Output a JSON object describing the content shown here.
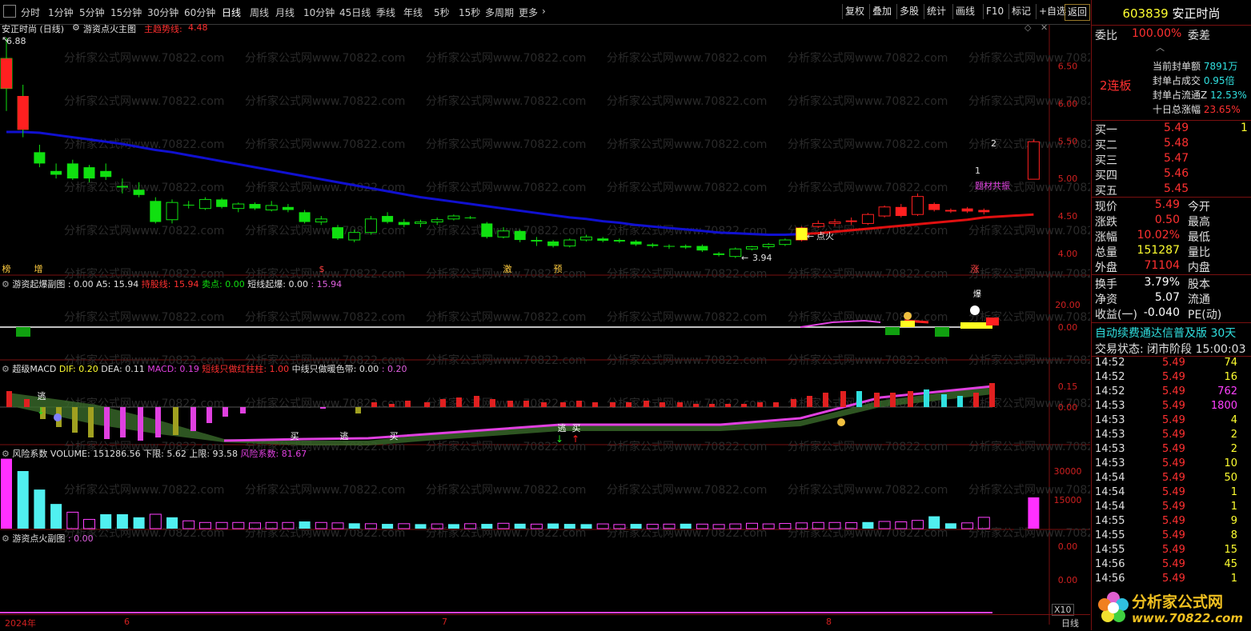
{
  "toolbar": {
    "menu_icon": "menu-icon",
    "periods": [
      "分时",
      "1分钟",
      "5分钟",
      "15分钟",
      "30分钟",
      "60分钟",
      "日线",
      "周线",
      "月线",
      "10分钟",
      "45日线",
      "季线",
      "年线",
      "5秒",
      "15秒",
      "多周期",
      "更多"
    ],
    "active_period": "日线",
    "right": [
      "复权",
      "叠加",
      "多股",
      "统计",
      "画线",
      "F10",
      "标记",
      "+自选",
      "返回"
    ]
  },
  "main": {
    "stock_title": "安正时尚 (日线)",
    "indicator_name": "游资点火主图",
    "trend_label": "主趋势线:",
    "trend_value": "4.48",
    "high_mark": "6.88",
    "low_mark": "3.94",
    "ignite_label": "点火",
    "theme_label": "题材共振",
    "num_1": "1",
    "num_2": "2",
    "y_ticks": [
      "6.50",
      "6.00",
      "5.50",
      "5.00",
      "4.50",
      "4.00"
    ],
    "tags": [
      "榜",
      "增",
      "$",
      "激",
      "预",
      "涨"
    ]
  },
  "panel2": {
    "title": "游资起爆副图 : 0.00",
    "a5": "A5: 15.94",
    "hold_label": "持股线:",
    "hold_value": "15.94",
    "sell_label": "卖点:",
    "sell_value": "0.00",
    "short_label": "短线起爆:",
    "short_value": "0.00",
    "extra_value": ": 15.94",
    "bao_label": "爆",
    "y_ticks": [
      "20.00",
      "0.00"
    ]
  },
  "panel3": {
    "title": "超级MACD",
    "dif": "DIF: 0.20",
    "dea": "DEA: 0.11",
    "macd": "MACD: 0.19",
    "short_red": "短线只做红柱柱:",
    "short_red_value": "1.00",
    "mid_warm": "中线只做暖色带:",
    "mid_warm_value": "0.00",
    "mid_warm_value2": ": 0.20",
    "escape_label": "逃",
    "buy_label": "买",
    "y_ticks": [
      "0.15",
      "0.00"
    ]
  },
  "panel4": {
    "title": "风险系数",
    "volume": "VOLUME: 151286.56",
    "lower": "下限: 5.62",
    "upper": "上限: 93.58",
    "risk": "风险系数: 81.67",
    "y_ticks": [
      "30000",
      "15000"
    ],
    "x10": "X10"
  },
  "panel5": {
    "title": "游资点火副图",
    "value": ": 0.00",
    "y_ticks": [
      "0.00",
      "0.00"
    ]
  },
  "date_axis": {
    "labels": [
      "2024年",
      "6",
      "7",
      "8"
    ],
    "period_btn": "日线"
  },
  "watermark": "分析家公式网www.70822.com",
  "side": {
    "code": "603839",
    "name": "安正时尚",
    "wei_bi_label": "委比",
    "wei_bi_value": "100.00%",
    "wei_cha_label": "委差",
    "lianban": "2连板",
    "seal": [
      {
        "label": "当前封单额",
        "value": "7891万"
      },
      {
        "label": "封单占成交",
        "value": "0.95倍"
      },
      {
        "label": "封单占流通Z",
        "value": "12.53%"
      },
      {
        "label": "十日总涨幅",
        "value": "23.65%"
      }
    ],
    "bids": [
      {
        "label": "买一",
        "price": "5.49",
        "vol": "1"
      },
      {
        "label": "买二",
        "price": "5.48",
        "vol": ""
      },
      {
        "label": "买三",
        "price": "5.47",
        "vol": ""
      },
      {
        "label": "买四",
        "price": "5.46",
        "vol": ""
      },
      {
        "label": "买五",
        "price": "5.45",
        "vol": ""
      }
    ],
    "quote": [
      {
        "l1": "现价",
        "v1": "5.49",
        "l2": "今开",
        "c": "red"
      },
      {
        "l1": "涨跌",
        "v1": "0.50",
        "l2": "最高",
        "c": "red"
      },
      {
        "l1": "涨幅",
        "v1": "10.02%",
        "l2": "最低",
        "c": "red"
      },
      {
        "l1": "总量",
        "v1": "151287",
        "l2": "量比",
        "c": "yellow"
      },
      {
        "l1": "外盘",
        "v1": "71104",
        "l2": "内盘",
        "c": "red"
      }
    ],
    "stats": [
      {
        "l1": "换手",
        "v1": "3.79%",
        "l2": "股本"
      },
      {
        "l1": "净资",
        "v1": "5.07",
        "l2": "流通"
      },
      {
        "l1": "收益(一)",
        "v1": "-0.040",
        "l2": "PE(动)"
      }
    ],
    "marquee": "自动续费通达信普及版  30天",
    "trade_status": "交易状态: 闭市阶段 15:00:03",
    "ticks": [
      {
        "t": "14:52",
        "p": "5.49",
        "v": "74",
        "c": "yellow"
      },
      {
        "t": "14:52",
        "p": "5.49",
        "v": "16",
        "c": "yellow"
      },
      {
        "t": "14:52",
        "p": "5.49",
        "v": "762",
        "c": "magenta"
      },
      {
        "t": "14:53",
        "p": "5.49",
        "v": "1800",
        "c": "magenta"
      },
      {
        "t": "14:53",
        "p": "5.49",
        "v": "4",
        "c": "yellow"
      },
      {
        "t": "14:53",
        "p": "5.49",
        "v": "2",
        "c": "yellow"
      },
      {
        "t": "14:53",
        "p": "5.49",
        "v": "2",
        "c": "yellow"
      },
      {
        "t": "14:53",
        "p": "5.49",
        "v": "10",
        "c": "yellow"
      },
      {
        "t": "14:54",
        "p": "5.49",
        "v": "50",
        "c": "yellow"
      },
      {
        "t": "14:54",
        "p": "5.49",
        "v": "1",
        "c": "yellow"
      },
      {
        "t": "14:54",
        "p": "5.49",
        "v": "1",
        "c": "yellow"
      },
      {
        "t": "14:55",
        "p": "5.49",
        "v": "9",
        "c": "yellow"
      },
      {
        "t": "14:55",
        "p": "5.49",
        "v": "8",
        "c": "yellow"
      },
      {
        "t": "14:55",
        "p": "5.49",
        "v": "15",
        "c": "yellow"
      },
      {
        "t": "14:56",
        "p": "5.49",
        "v": "45",
        "c": "yellow"
      },
      {
        "t": "14:56",
        "p": "5.49",
        "v": "1",
        "c": "yellow"
      }
    ],
    "logo_text": "分析家公式网",
    "logo_url": "www.70822.com"
  },
  "chart_data": [
    {
      "type": "candlestick",
      "title": "安正时尚 (日线)",
      "ylim": [
        3.85,
        6.9
      ],
      "candles": [
        [
          6.2,
          6.88,
          5.9,
          6.6
        ],
        [
          6.1,
          6.25,
          5.55,
          5.65
        ],
        [
          5.35,
          5.45,
          5.15,
          5.2
        ],
        [
          5.1,
          5.2,
          5.0,
          5.05
        ],
        [
          5.2,
          5.25,
          4.98,
          5.0
        ],
        [
          5.15,
          5.18,
          4.95,
          5.0
        ],
        [
          5.1,
          5.2,
          4.98,
          5.02
        ],
        [
          4.9,
          5.0,
          4.8,
          4.88
        ],
        [
          4.85,
          4.95,
          4.75,
          4.78
        ],
        [
          4.7,
          4.75,
          4.4,
          4.42
        ],
        [
          4.45,
          4.72,
          4.4,
          4.68
        ],
        [
          4.65,
          4.7,
          4.6,
          4.64
        ],
        [
          4.6,
          4.75,
          4.58,
          4.72
        ],
        [
          4.72,
          4.74,
          4.6,
          4.62
        ],
        [
          4.6,
          4.68,
          4.55,
          4.66
        ],
        [
          4.66,
          4.68,
          4.58,
          4.6
        ],
        [
          4.58,
          4.7,
          4.56,
          4.64
        ],
        [
          4.62,
          4.66,
          4.55,
          4.58
        ],
        [
          4.55,
          4.58,
          4.4,
          4.42
        ],
        [
          4.42,
          4.5,
          4.38,
          4.46
        ],
        [
          4.35,
          4.38,
          4.18,
          4.2
        ],
        [
          4.18,
          4.32,
          4.15,
          4.28
        ],
        [
          4.28,
          4.5,
          4.25,
          4.46
        ],
        [
          4.5,
          4.55,
          4.4,
          4.42
        ],
        [
          4.42,
          4.46,
          4.35,
          4.38
        ],
        [
          4.4,
          4.45,
          4.35,
          4.42
        ],
        [
          4.42,
          4.48,
          4.38,
          4.45
        ],
        [
          4.46,
          4.52,
          4.44,
          4.5
        ],
        [
          4.48,
          4.5,
          4.46,
          4.47
        ],
        [
          4.4,
          4.42,
          4.2,
          4.22
        ],
        [
          4.22,
          4.35,
          4.2,
          4.3
        ],
        [
          4.3,
          4.32,
          4.15,
          4.18
        ],
        [
          4.18,
          4.22,
          4.1,
          4.16
        ],
        [
          4.16,
          4.18,
          4.08,
          4.1
        ],
        [
          4.1,
          4.2,
          4.08,
          4.18
        ],
        [
          4.18,
          4.25,
          4.16,
          4.22
        ],
        [
          4.2,
          4.22,
          4.15,
          4.17
        ],
        [
          4.18,
          4.2,
          4.14,
          4.16
        ],
        [
          4.16,
          4.18,
          4.1,
          4.12
        ],
        [
          4.12,
          4.14,
          4.08,
          4.1
        ],
        [
          4.1,
          4.12,
          4.06,
          4.09
        ],
        [
          4.1,
          4.12,
          4.06,
          4.08
        ],
        [
          4.1,
          4.12,
          4.02,
          4.04
        ],
        [
          4.0,
          4.02,
          3.96,
          3.98
        ],
        [
          3.96,
          4.08,
          3.94,
          4.06
        ],
        [
          4.06,
          4.1,
          4.04,
          4.09
        ],
        [
          4.09,
          4.14,
          4.06,
          4.12
        ],
        [
          4.12,
          4.2,
          4.1,
          4.18
        ],
        [
          4.18,
          4.36,
          4.16,
          4.34
        ],
        [
          4.36,
          4.44,
          4.34,
          4.4
        ],
        [
          4.4,
          4.46,
          4.36,
          4.42
        ],
        [
          4.44,
          4.48,
          4.38,
          4.42
        ],
        [
          4.4,
          4.54,
          4.38,
          4.52
        ],
        [
          4.5,
          4.64,
          4.48,
          4.62
        ],
        [
          4.62,
          4.66,
          4.48,
          4.5
        ],
        [
          4.52,
          4.8,
          4.5,
          4.76
        ],
        [
          4.66,
          4.68,
          4.56,
          4.58
        ],
        [
          4.58,
          4.6,
          4.54,
          4.56
        ],
        [
          4.6,
          4.62,
          4.54,
          4.56
        ],
        [
          4.58,
          4.6,
          4.52,
          4.55
        ],
        [
          4.99,
          5.52,
          4.99,
          5.49
        ]
      ],
      "candle_x_index_skip": [
        59
      ],
      "ma": [
        5.62,
        5.62,
        5.61,
        5.58,
        5.55,
        5.52,
        5.49,
        5.46,
        5.42,
        5.38,
        5.35,
        5.31,
        5.27,
        5.23,
        5.19,
        5.15,
        5.11,
        5.07,
        5.03,
        4.99,
        4.95,
        4.91,
        4.87,
        4.83,
        4.79,
        4.75,
        4.72,
        4.69,
        4.66,
        4.63,
        4.6,
        4.57,
        4.54,
        4.51,
        4.48,
        4.46,
        4.43,
        4.41,
        4.38,
        4.36,
        4.34,
        4.32,
        4.3,
        4.28,
        4.27,
        4.26,
        4.25,
        4.25,
        4.26,
        4.27,
        4.29,
        4.31,
        4.33,
        4.35,
        4.37,
        4.39,
        4.41,
        4.43,
        4.45,
        4.48,
        4.52
      ]
    },
    {
      "type": "bar",
      "title": "风险系数 VOLUME",
      "ylim": [
        0,
        35000
      ],
      "values": [
        34000,
        28000,
        19000,
        12000,
        8000,
        4500,
        7000,
        7000,
        5500,
        7000,
        5500,
        3800,
        3000,
        3000,
        3000,
        2800,
        3000,
        3000,
        3500,
        3000,
        2800,
        2600,
        2400,
        2300,
        2400,
        2200,
        2300,
        2200,
        2400,
        2300,
        2600,
        2400,
        2200,
        2500,
        2300,
        2200,
        2300,
        2000,
        2300,
        2100,
        2200,
        2400,
        2200,
        2000,
        2300,
        2600,
        2300,
        2500,
        2800,
        3000,
        3000,
        2900,
        3200,
        3500,
        3300,
        4000,
        6000,
        2600,
        2800,
        5500,
        15200
      ],
      "colors": [
        "magenta",
        "cyan",
        "cyan",
        "cyan",
        "magenta",
        "magenta",
        "cyan",
        "cyan",
        "cyan",
        "magenta",
        "cyan",
        "magenta",
        "magenta",
        "magenta",
        "magenta",
        "magenta",
        "magenta",
        "magenta",
        "cyan",
        "magenta",
        "magenta",
        "cyan",
        "magenta",
        "cyan",
        "magenta",
        "cyan",
        "magenta",
        "cyan",
        "magenta",
        "cyan",
        "magenta",
        "cyan",
        "magenta",
        "cyan",
        "cyan",
        "cyan",
        "magenta",
        "magenta",
        "cyan",
        "magenta",
        "magenta",
        "cyan",
        "magenta",
        "magenta",
        "magenta",
        "magenta",
        "magenta",
        "magenta",
        "magenta",
        "magenta",
        "magenta",
        "magenta",
        "cyan",
        "magenta",
        "magenta",
        "magenta",
        "cyan",
        "cyan",
        "magenta",
        "magenta",
        "magenta"
      ]
    }
  ]
}
